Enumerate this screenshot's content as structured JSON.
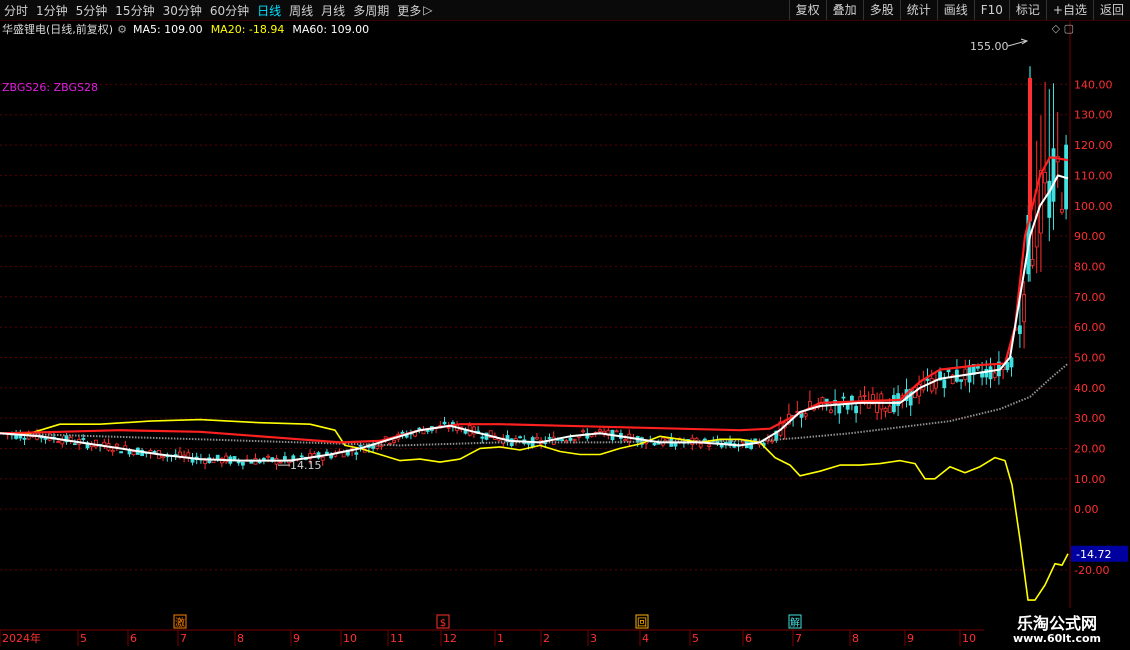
{
  "toolbar": {
    "periods": [
      {
        "label": "分时",
        "active": false
      },
      {
        "label": "1分钟",
        "active": false
      },
      {
        "label": "5分钟",
        "active": false
      },
      {
        "label": "15分钟",
        "active": false
      },
      {
        "label": "30分钟",
        "active": false
      },
      {
        "label": "60分钟",
        "active": false
      },
      {
        "label": "日线",
        "active": true
      },
      {
        "label": "周线",
        "active": false
      },
      {
        "label": "月线",
        "active": false
      },
      {
        "label": "多周期",
        "active": false
      },
      {
        "label": "更多",
        "active": false
      }
    ],
    "more_arrow": "▷",
    "tools": [
      "复权",
      "叠加",
      "多股",
      "统计",
      "画线",
      "F10",
      "标记",
      "+自选",
      "返回"
    ]
  },
  "legend": {
    "stock": "华盛锂电(日线,前复权)",
    "ma5": "MA5: 109.00",
    "ma20": "MA20: -18.94",
    "ma60": "MA60: 109.00",
    "ma5_color": "#ffffff",
    "ma20_color": "#ffff00",
    "ma60_color": "#ffffff"
  },
  "formula_label": "ZBGS26: ZBGS28",
  "colors": {
    "up": "#ff3030",
    "down": "#40e0e0",
    "red_line": "#ff2020",
    "white_line": "#ffffff",
    "yellow_line": "#ffff00",
    "grey_line": "#909090",
    "grid": "#5a0000",
    "axis_text": "#ff3030",
    "current_box": "#0000a0"
  },
  "chart_data": {
    "type": "candlestick",
    "ylim": [
      -26,
      152
    ],
    "y_ticks": [
      "140.00",
      "130.00",
      "120.00",
      "110.00",
      "100.00",
      "90.00",
      "80.00",
      "70.00",
      "60.00",
      "50.00",
      "40.00",
      "30.00",
      "20.00",
      "10.00",
      "0.00",
      "-20.00"
    ],
    "y_tick_values": [
      140,
      130,
      120,
      110,
      100,
      90,
      80,
      70,
      60,
      50,
      40,
      30,
      20,
      10,
      0,
      -20
    ],
    "current_value_label": "-14.72",
    "current_value": -14.72,
    "high_label": "155.00",
    "low_label": "14.15",
    "months": [
      "2024年",
      "5",
      "6",
      "7",
      "8",
      "9",
      "10",
      "11",
      "12",
      "1",
      "2",
      "3",
      "4",
      "5",
      "6",
      "7",
      "8",
      "9",
      "10"
    ],
    "events": [
      {
        "label": "激",
        "month_index": 3
      },
      {
        "label": "$",
        "month_index": 8
      },
      {
        "label": "回",
        "month_index": 12
      },
      {
        "label": "解",
        "month_index": 15
      }
    ],
    "red_line": [
      [
        0,
        25
      ],
      [
        60,
        25.5
      ],
      [
        120,
        26
      ],
      [
        200,
        25.5
      ],
      [
        280,
        23.5
      ],
      [
        340,
        22
      ],
      [
        380,
        22.5
      ],
      [
        420,
        26
      ],
      [
        460,
        28
      ],
      [
        500,
        28
      ],
      [
        560,
        27.5
      ],
      [
        620,
        27
      ],
      [
        680,
        26.5
      ],
      [
        740,
        26
      ],
      [
        770,
        26.5
      ],
      [
        790,
        30
      ],
      [
        820,
        35
      ],
      [
        860,
        35.5
      ],
      [
        900,
        36
      ],
      [
        920,
        42
      ],
      [
        940,
        46
      ],
      [
        980,
        47.5
      ],
      [
        1005,
        48
      ],
      [
        1015,
        60
      ],
      [
        1025,
        90
      ],
      [
        1040,
        110
      ],
      [
        1050,
        116
      ],
      [
        1060,
        115.5
      ],
      [
        1068,
        115
      ]
    ],
    "white_line": [
      [
        0,
        25
      ],
      [
        40,
        24
      ],
      [
        80,
        22
      ],
      [
        120,
        20
      ],
      [
        160,
        18
      ],
      [
        200,
        16.5
      ],
      [
        240,
        16
      ],
      [
        290,
        16
      ],
      [
        330,
        18
      ],
      [
        360,
        20
      ],
      [
        380,
        22
      ],
      [
        400,
        24
      ],
      [
        420,
        26
      ],
      [
        450,
        27.5
      ],
      [
        480,
        25
      ],
      [
        510,
        22.5
      ],
      [
        540,
        22
      ],
      [
        570,
        24
      ],
      [
        600,
        25
      ],
      [
        630,
        23.5
      ],
      [
        660,
        22
      ],
      [
        700,
        22
      ],
      [
        740,
        21
      ],
      [
        760,
        22
      ],
      [
        780,
        26
      ],
      [
        800,
        32
      ],
      [
        820,
        34
      ],
      [
        860,
        35
      ],
      [
        900,
        35
      ],
      [
        920,
        40
      ],
      [
        940,
        43
      ],
      [
        980,
        45
      ],
      [
        1000,
        46
      ],
      [
        1010,
        50
      ],
      [
        1020,
        70
      ],
      [
        1030,
        90
      ],
      [
        1040,
        100
      ],
      [
        1050,
        105
      ],
      [
        1058,
        110
      ],
      [
        1068,
        109
      ]
    ],
    "grey_line": [
      [
        0,
        25
      ],
      [
        100,
        24
      ],
      [
        200,
        23
      ],
      [
        300,
        22
      ],
      [
        350,
        21.5
      ],
      [
        400,
        21
      ],
      [
        450,
        21.5
      ],
      [
        500,
        22
      ],
      [
        600,
        22
      ],
      [
        700,
        22.5
      ],
      [
        760,
        22.5
      ],
      [
        800,
        23.5
      ],
      [
        850,
        25
      ],
      [
        900,
        27
      ],
      [
        950,
        29
      ],
      [
        1000,
        33
      ],
      [
        1030,
        37
      ],
      [
        1050,
        43
      ],
      [
        1068,
        48
      ]
    ],
    "yellow_line": [
      [
        0,
        25
      ],
      [
        30,
        25
      ],
      [
        60,
        28
      ],
      [
        100,
        28
      ],
      [
        150,
        29
      ],
      [
        200,
        29.5
      ],
      [
        260,
        28.5
      ],
      [
        310,
        28
      ],
      [
        335,
        26
      ],
      [
        345,
        21
      ],
      [
        360,
        20
      ],
      [
        380,
        18
      ],
      [
        400,
        16
      ],
      [
        420,
        16.5
      ],
      [
        440,
        15.5
      ],
      [
        460,
        16.5
      ],
      [
        480,
        20
      ],
      [
        500,
        20.5
      ],
      [
        520,
        19.5
      ],
      [
        540,
        21
      ],
      [
        560,
        19
      ],
      [
        580,
        18
      ],
      [
        600,
        18
      ],
      [
        620,
        20
      ],
      [
        640,
        21.5
      ],
      [
        660,
        24
      ],
      [
        680,
        23
      ],
      [
        700,
        22
      ],
      [
        720,
        23
      ],
      [
        740,
        23
      ],
      [
        760,
        22
      ],
      [
        775,
        17
      ],
      [
        790,
        14.5
      ],
      [
        800,
        11
      ],
      [
        820,
        12.5
      ],
      [
        840,
        14.5
      ],
      [
        860,
        14.5
      ],
      [
        880,
        15
      ],
      [
        900,
        16
      ],
      [
        915,
        15
      ],
      [
        925,
        10
      ],
      [
        935,
        10
      ],
      [
        950,
        14
      ],
      [
        965,
        12
      ],
      [
        980,
        14
      ],
      [
        995,
        17
      ],
      [
        1005,
        16
      ],
      [
        1012,
        8
      ],
      [
        1020,
        -10
      ],
      [
        1028,
        -30
      ],
      [
        1035,
        -30
      ],
      [
        1045,
        -25
      ],
      [
        1055,
        -18
      ],
      [
        1062,
        -18.5
      ],
      [
        1068,
        -14.72
      ]
    ]
  }
}
